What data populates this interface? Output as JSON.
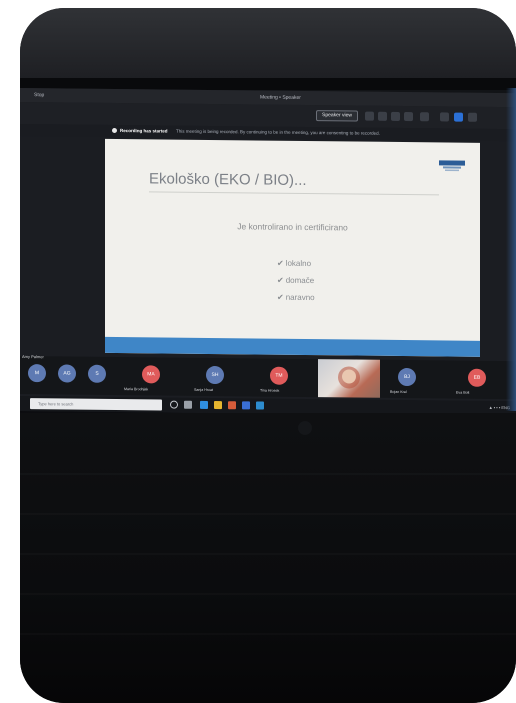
{
  "titlebar": {
    "app_label": "Stop",
    "window_title": "Meeting • Speaker"
  },
  "toolbar": {
    "view_label": "Speaker view"
  },
  "recording_banner": {
    "title": "Recording has started",
    "text": "This meeting is being recorded. By continuing to be in the meeting, you are consenting to be recorded."
  },
  "slide": {
    "title": "Ekološko (EKO / BIO)...",
    "subtitle": "Je kontrolirano in certificirano",
    "bullets": [
      "lokalno",
      "domače",
      "naravno"
    ],
    "bullet_mark": "✔"
  },
  "participants": {
    "left_label": "Amy Palmer",
    "people": [
      {
        "initials": "M",
        "name": ""
      },
      {
        "initials": "AG",
        "name": ""
      },
      {
        "initials": "S",
        "name": ""
      },
      {
        "initials": "MA",
        "name": "Maria Brodnjak"
      },
      {
        "initials": "SH",
        "name": "Sanja Hroat"
      },
      {
        "initials": "TM",
        "name": "Tina Hrosek"
      },
      {
        "initials": "BJ",
        "name": "Bojan Kral"
      },
      {
        "initials": "EB",
        "name": "Eva Bolt"
      }
    ]
  },
  "taskbar": {
    "search_placeholder": "Type here to search",
    "tray_text": "▲ • • • ENG"
  },
  "colors": {
    "slide_footer": "#3f86c7",
    "avatar_red": "#e05b5b",
    "avatar_grey": "#5e7ab3"
  }
}
